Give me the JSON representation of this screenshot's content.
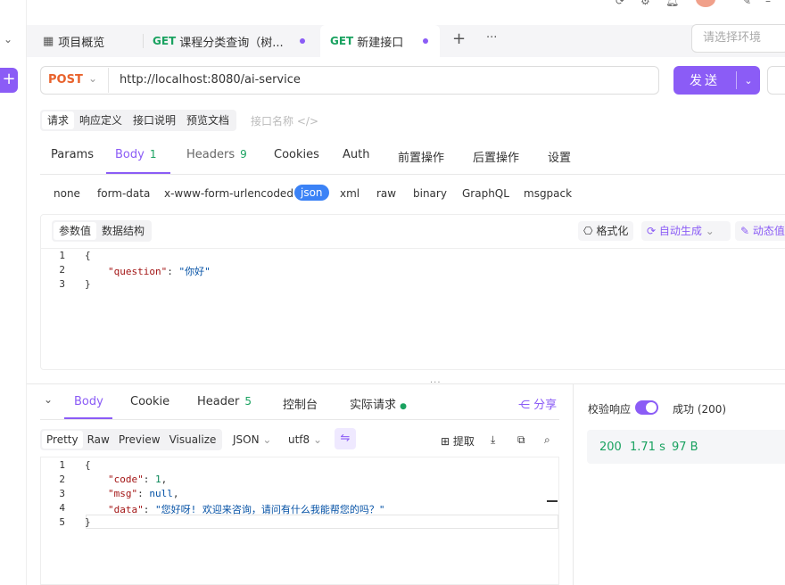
{
  "tabs": {
    "overview": "项目概览",
    "tab1_method": "GET",
    "tab1_label": "课程分类查询（树...",
    "tab2_method": "GET",
    "tab2_label": "新建接口",
    "add": "+",
    "more": "···"
  },
  "env": {
    "placeholder": "请选择环境"
  },
  "request": {
    "method": "POST",
    "url": "http://localhost:8080/ai-service",
    "send": "发送"
  },
  "subtabs": [
    "请求",
    "响应定义",
    "接口说明",
    "预览文档"
  ],
  "interface_name_placeholder": "接口名称",
  "param_tabs": {
    "params": "Params",
    "body": "Body",
    "body_count": "1",
    "headers": "Headers",
    "headers_count": "9",
    "cookies": "Cookies",
    "auth": "Auth",
    "pre": "前置操作",
    "post": "后置操作",
    "settings": "设置"
  },
  "body_types": [
    "none",
    "form-data",
    "x-www-form-urlencoded",
    "json",
    "xml",
    "raw",
    "binary",
    "GraphQL",
    "msgpack"
  ],
  "body_type_selected": "json",
  "editor": {
    "view_tabs": [
      "参数值",
      "数据结构"
    ],
    "format": "格式化",
    "autogen": "自动生成",
    "dynamic": "动态值",
    "lines": [
      "1",
      "2",
      "3"
    ],
    "key": "\"question\"",
    "value": "\"你好\""
  },
  "response": {
    "tabs": {
      "body": "Body",
      "cookie": "Cookie",
      "header": "Header",
      "header_count": "5",
      "console": "控制台",
      "actual": "实际请求"
    },
    "share": "分享",
    "formats": [
      "Pretty",
      "Raw",
      "Preview",
      "Visualize"
    ],
    "lang": "JSON",
    "encoding": "utf8",
    "extract": "提取",
    "lines": [
      "1",
      "2",
      "3",
      "4",
      "5"
    ],
    "code_key": "\"code\"",
    "code_val": "1",
    "msg_key": "\"msg\"",
    "msg_val": "null",
    "data_key": "\"data\"",
    "data_val": "\"您好呀! 欢迎来咨询，请问有什么我能帮您的吗？\"",
    "validate": "校验响应",
    "success": "成功 (200)",
    "status": "200",
    "time": "1.71 s",
    "size": "97 B"
  },
  "colors": {
    "accent": "#8b5cf6",
    "get": "#1aa260",
    "post": "#e8622c"
  }
}
